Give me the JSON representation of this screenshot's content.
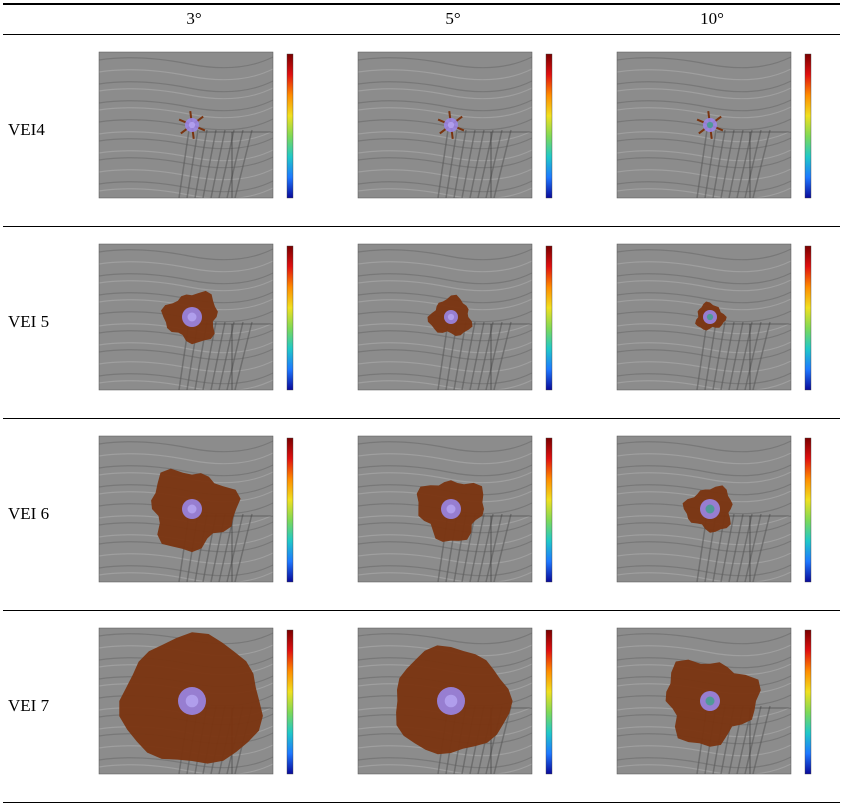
{
  "table": {
    "columns": [
      "3°",
      "5°",
      "10°"
    ],
    "rows": [
      {
        "label": "VEI4",
        "flow_extent": [
          0.05,
          0.04,
          0.03
        ]
      },
      {
        "label": "VEI 5",
        "flow_extent": [
          0.3,
          0.2,
          0.1
        ]
      },
      {
        "label": "VEI 6",
        "flow_extent": [
          0.55,
          0.4,
          0.25
        ]
      },
      {
        "label": "VEI 7",
        "flow_extent": [
          1.0,
          0.8,
          0.6
        ]
      }
    ]
  },
  "colors": {
    "flow": "#7a3410",
    "vent": "#9a86e6",
    "hillshade": "#8c8c8c",
    "colorbar": [
      "#7a0000",
      "#e01010",
      "#ff8c00",
      "#f0e020",
      "#7ed957",
      "#20c8c8",
      "#1e78ff",
      "#0a0a9a"
    ]
  }
}
